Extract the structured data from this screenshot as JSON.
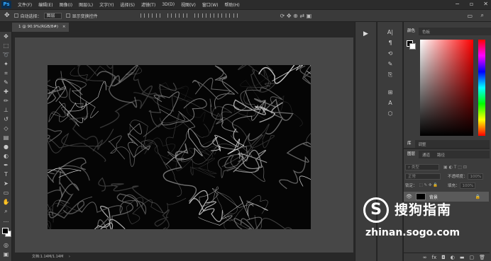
{
  "app": {
    "logo": "Ps"
  },
  "menu": [
    "文件(F)",
    "编辑(E)",
    "图像(I)",
    "图层(L)",
    "文字(Y)",
    "选择(S)",
    "滤镜(T)",
    "3D(D)",
    "视图(V)",
    "窗口(W)",
    "帮助(H)"
  ],
  "options": {
    "auto_select_label": "自动选择：",
    "auto_select_value": "图层",
    "show_transform_label": "显示变换控件"
  },
  "document": {
    "tab_title": "1 @ 90.9%(RGB/8#)",
    "status": "文档:1.14M/1.14M",
    "image_description_icon": "texture-image"
  },
  "panels": {
    "color_tabs": [
      "颜色",
      "色板"
    ],
    "library_tabs": [
      "库",
      "调整"
    ],
    "layers_tabs": [
      "图层",
      "通道",
      "路径"
    ],
    "kind_placeholder": "类型",
    "blend_mode": "正常",
    "opacity_label": "不透明度：",
    "opacity_value": "100%",
    "lock_label": "锁定：",
    "fill_label": "填充：",
    "fill_value": "100%",
    "layer_name": "背景",
    "fg_color": "#000000",
    "bg_color": "#ffffff"
  },
  "watermark": {
    "name": "搜狗指南",
    "url": "zhinan.sogo.com",
    "logo_char": "S"
  }
}
